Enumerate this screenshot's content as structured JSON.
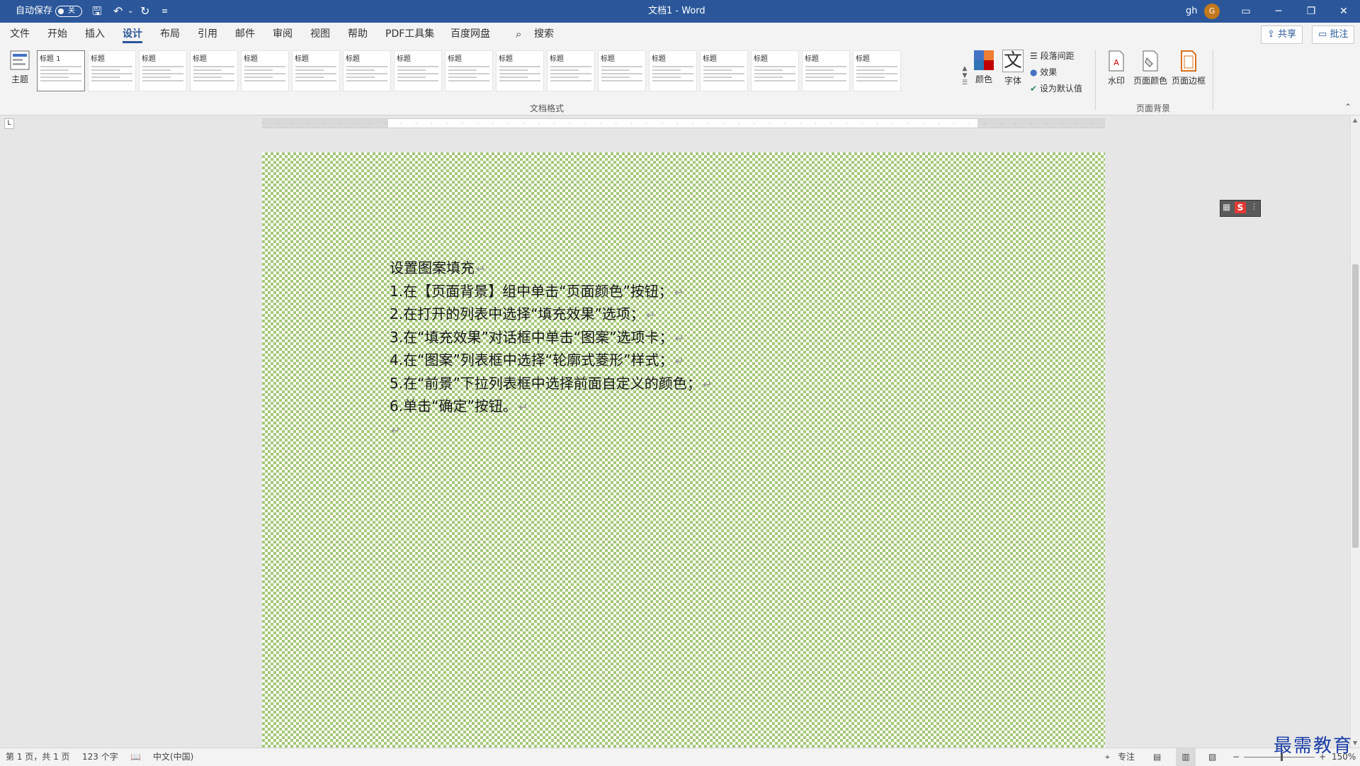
{
  "titlebar": {
    "autosave_label": "自动保存",
    "autosave_state": "关",
    "doc_title": "文档1  -  Word",
    "user_name": "gh",
    "avatar_initial": "G",
    "minimize": "─",
    "restore": "❐",
    "close": "✕",
    "ribbon_display": "▭"
  },
  "menu": {
    "tabs": [
      "文件",
      "开始",
      "插入",
      "设计",
      "布局",
      "引用",
      "邮件",
      "审阅",
      "视图",
      "帮助",
      "PDF工具集",
      "百度网盘"
    ],
    "active_tab": "设计",
    "search_placeholder": "搜索",
    "share": "共享",
    "comments": "批注"
  },
  "ribbon": {
    "themes_label": "主题",
    "gallery_titles": [
      "标题 1",
      "标题",
      "标题",
      "标题",
      "标题",
      "标题",
      "标题",
      "标题",
      "标题",
      "标题",
      "标题",
      "标题",
      "标题",
      "标题",
      "标题",
      "标题",
      "标题"
    ],
    "colors_label": "颜色",
    "fonts_label": "字体",
    "paragraph_spacing": "段落间距",
    "effects": "效果",
    "set_default": "设为默认值",
    "doc_format_group": "文档格式",
    "watermark": "水印",
    "page_color": "页面颜色",
    "page_border": "页面边框",
    "page_background_group": "页面背景"
  },
  "document": {
    "title_line": "设置图案填充",
    "steps": [
      "1.在【页面背景】组中单击“页面颜色”按钮；",
      "2.在打开的列表中选择“填充效果”选项；",
      "3.在“填充效果”对话框中单击“图案”选项卡；",
      "4.在“图案”列表框中选择“轮廓式菱形”样式；",
      "5.在“前景”下拉列表框中选择前面自定义的颜色；",
      "6.单击“确定”按钮。"
    ],
    "pattern_color": "#a6c87a"
  },
  "status": {
    "page": "第 1 页，共 1 页",
    "words": "123 个字",
    "language": "中文(中国)",
    "focus": "专注",
    "zoom": "150%",
    "minus": "−",
    "plus": "+"
  },
  "watermark_text": "最需教育"
}
